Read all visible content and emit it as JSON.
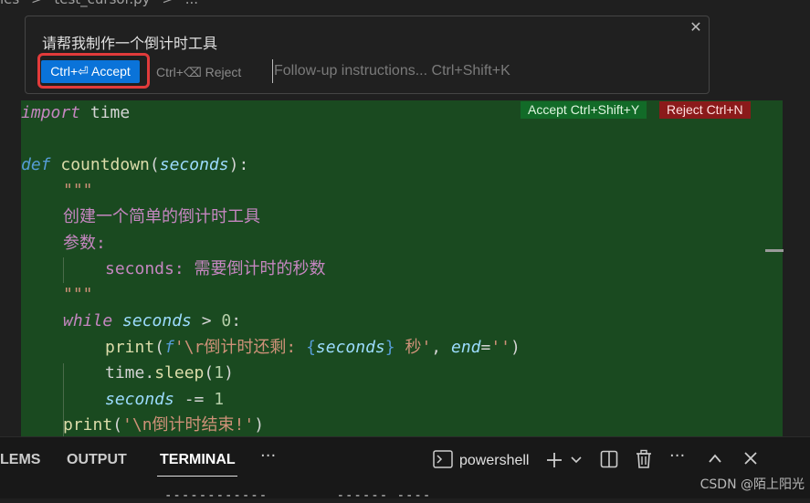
{
  "breadcrumb": {
    "items": [
      "les",
      ">",
      "test_cursor.py",
      ">",
      "..."
    ]
  },
  "inline_chat": {
    "prompt": "请帮我制作一个倒计时工具",
    "accept_label": "Ctrl+⏎ Accept",
    "reject_label": "Ctrl+⌫ Reject",
    "followup_placeholder": "Follow-up instructions... Ctrl+Shift+K",
    "close_icon": "✕"
  },
  "diff_actions": {
    "accept_label": "Accept Ctrl+Shift+Y",
    "reject_label": "Reject Ctrl+N"
  },
  "code": {
    "l1_kw": "import",
    "l1_mod": " time",
    "l3_def": "def ",
    "l3_fn": "countdown",
    "l3_p1": "(",
    "l3_param": "seconds",
    "l3_p2": "):",
    "l4": "\"\"\"",
    "l5": "创建一个简单的倒计时工具",
    "l6": "参数:",
    "l7": "seconds: 需要倒计时的秒数",
    "l8": "\"\"\"",
    "l9_kw": "while",
    "l9_var": " seconds",
    "l9_op": " > ",
    "l9_num": "0",
    "l9_end": ":",
    "l10_fn": "print",
    "l10_a": "(",
    "l10_f": "f",
    "l10_s1": "'\\r倒计时还剩: ",
    "l10_b1": "{",
    "l10_var": "seconds",
    "l10_b2": "}",
    "l10_s2": " 秒'",
    "l10_c": ", ",
    "l10_kw": "end",
    "l10_eq": "=",
    "l10_s3": "''",
    "l10_e": ")",
    "l11_mod": "time",
    "l11_dot": ".",
    "l11_fn": "sleep",
    "l11_a": "(",
    "l11_num": "1",
    "l11_e": ")",
    "l12_var": "seconds",
    "l12_op": " -= ",
    "l12_num": "1",
    "l13_fn": "print",
    "l13_a": "(",
    "l13_s": "'\\n倒计时结束!'",
    "l13_e": ")"
  },
  "panel": {
    "tabs": [
      "LEMS",
      "OUTPUT",
      "TERMINAL"
    ],
    "more_label": "···",
    "terminal_label": "powershell",
    "dashes": "------------        ------ ----"
  },
  "watermark": "CSDN @陌上阳光"
}
